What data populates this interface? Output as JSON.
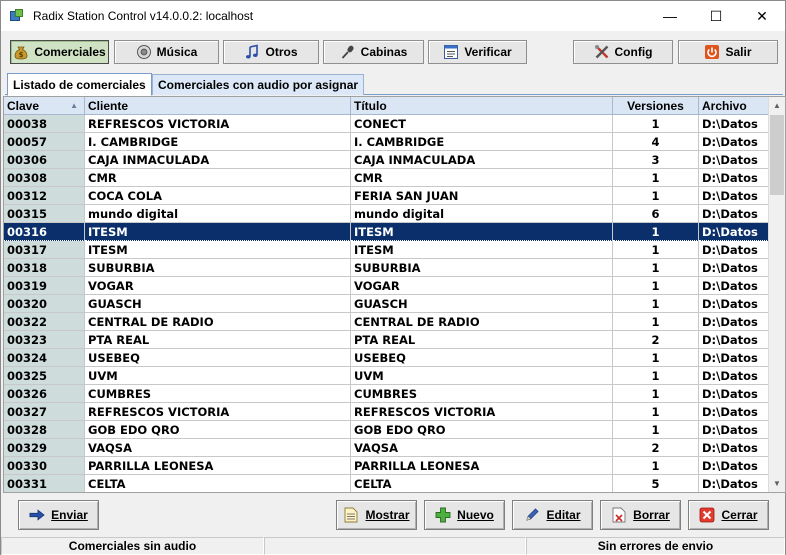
{
  "window": {
    "title": "Radix Station Control v14.0.0.2: localhost",
    "minimize": "—",
    "maximize": "☐",
    "close": "✕"
  },
  "toolbar": {
    "comerciales": "Comerciales",
    "musica": "Música",
    "otros": "Otros",
    "cabinas": "Cabinas",
    "verificar": "Verificar",
    "config": "Config",
    "salir": "Salir"
  },
  "tabs": [
    {
      "label": "Listado de comerciales"
    },
    {
      "label": "Comerciales con audio por asignar"
    }
  ],
  "grid": {
    "columns": [
      "Clave",
      "Cliente",
      "Título",
      "Versiones",
      "Archivo"
    ],
    "sort_indicator": "▲",
    "selected_index": 6,
    "rows": [
      {
        "clave": "00038",
        "cliente": "REFRESCOS VICTORIA",
        "titulo": "CONECT",
        "versiones": "1",
        "archivo": "D:\\Datos"
      },
      {
        "clave": "00057",
        "cliente": "I. CAMBRIDGE",
        "titulo": "I. CAMBRIDGE",
        "versiones": "4",
        "archivo": "D:\\Datos"
      },
      {
        "clave": "00306",
        "cliente": "CAJA INMACULADA",
        "titulo": "CAJA INMACULADA",
        "versiones": "3",
        "archivo": "D:\\Datos"
      },
      {
        "clave": "00308",
        "cliente": "CMR",
        "titulo": "CMR",
        "versiones": "1",
        "archivo": "D:\\Datos"
      },
      {
        "clave": "00312",
        "cliente": "COCA COLA",
        "titulo": "FERIA SAN JUAN",
        "versiones": "1",
        "archivo": "D:\\Datos"
      },
      {
        "clave": "00315",
        "cliente": "mundo digital",
        "titulo": "mundo digital",
        "versiones": "6",
        "archivo": "D:\\Datos"
      },
      {
        "clave": "00316",
        "cliente": "ITESM",
        "titulo": "ITESM",
        "versiones": "1",
        "archivo": "D:\\Datos"
      },
      {
        "clave": "00317",
        "cliente": "ITESM",
        "titulo": "ITESM",
        "versiones": "1",
        "archivo": "D:\\Datos"
      },
      {
        "clave": "00318",
        "cliente": "SUBURBIA",
        "titulo": "SUBURBIA",
        "versiones": "1",
        "archivo": "D:\\Datos"
      },
      {
        "clave": "00319",
        "cliente": "VOGAR",
        "titulo": "VOGAR",
        "versiones": "1",
        "archivo": "D:\\Datos"
      },
      {
        "clave": "00320",
        "cliente": "GUASCH",
        "titulo": "GUASCH",
        "versiones": "1",
        "archivo": "D:\\Datos"
      },
      {
        "clave": "00322",
        "cliente": "CENTRAL DE RADIO",
        "titulo": "CENTRAL DE RADIO",
        "versiones": "1",
        "archivo": "D:\\Datos"
      },
      {
        "clave": "00323",
        "cliente": "PTA REAL",
        "titulo": "PTA REAL",
        "versiones": "2",
        "archivo": "D:\\Datos"
      },
      {
        "clave": "00324",
        "cliente": "USEBEQ",
        "titulo": "USEBEQ",
        "versiones": "1",
        "archivo": "D:\\Datos"
      },
      {
        "clave": "00325",
        "cliente": "UVM",
        "titulo": "UVM",
        "versiones": "1",
        "archivo": "D:\\Datos"
      },
      {
        "clave": "00326",
        "cliente": "CUMBRES",
        "titulo": "CUMBRES",
        "versiones": "1",
        "archivo": "D:\\Datos"
      },
      {
        "clave": "00327",
        "cliente": "REFRESCOS VICTORIA",
        "titulo": "REFRESCOS VICTORIA",
        "versiones": "1",
        "archivo": "D:\\Datos"
      },
      {
        "clave": "00328",
        "cliente": "GOB EDO QRO",
        "titulo": "GOB EDO QRO",
        "versiones": "1",
        "archivo": "D:\\Datos"
      },
      {
        "clave": "00329",
        "cliente": "VAQSA",
        "titulo": "VAQSA",
        "versiones": "2",
        "archivo": "D:\\Datos"
      },
      {
        "clave": "00330",
        "cliente": "PARRILLA LEONESA",
        "titulo": "PARRILLA LEONESA",
        "versiones": "1",
        "archivo": "D:\\Datos"
      },
      {
        "clave": "00331",
        "cliente": "CELTA",
        "titulo": "CELTA",
        "versiones": "5",
        "archivo": "D:\\Datos"
      }
    ]
  },
  "actions": {
    "enviar": "Enviar",
    "mostrar": "Mostrar",
    "nuevo": "Nuevo",
    "editar": "Editar",
    "borrar": "Borrar",
    "cerrar": "Cerrar"
  },
  "status": {
    "left": "Comerciales sin audio",
    "middle": "",
    "right": "Sin errores de envio"
  },
  "colors": {
    "selection": "#0a2f6b",
    "header": "#dbe6f4",
    "key_column": "#cfdcdc"
  }
}
